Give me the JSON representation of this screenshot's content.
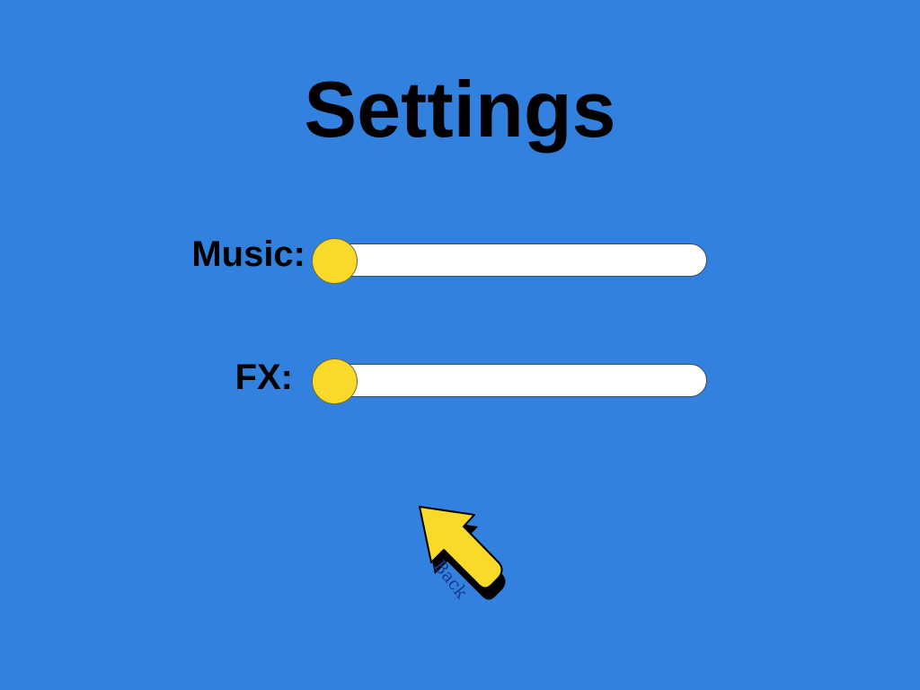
{
  "screen": {
    "title": "Settings",
    "background_color": "#3281de"
  },
  "sliders": {
    "music": {
      "label": "Music:",
      "value": 0
    },
    "fx": {
      "label": "FX:",
      "value": 0
    },
    "knob_color": "#f9d92a",
    "track_color": "#ffffff"
  },
  "back_button": {
    "label": "Back",
    "icon": "up-left-arrow-icon",
    "color": "#f9d92a"
  }
}
